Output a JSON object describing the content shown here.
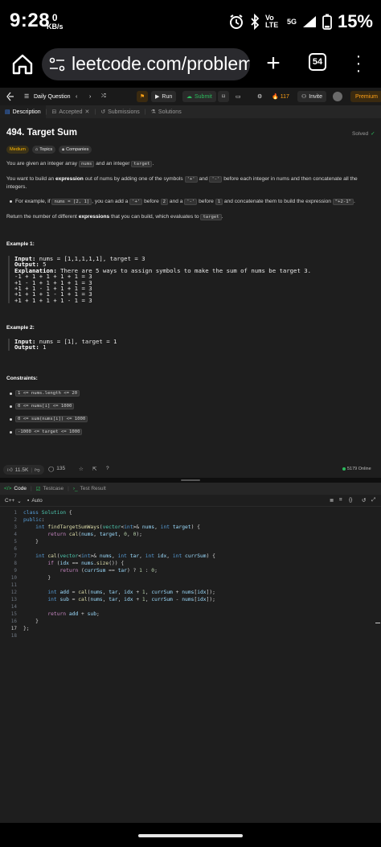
{
  "status_bar": {
    "time": "9:28",
    "net_speed_value": "0",
    "net_speed_unit": "KB/s",
    "network_label": "Vo LTE",
    "signal_label": "5G",
    "battery": "15%"
  },
  "browser": {
    "url": "leetcode.com/problem",
    "tab_count": "54"
  },
  "lc_toolbar": {
    "daily_question": "Daily Question",
    "run": "Run",
    "submit": "Submit",
    "streak": "117",
    "invite": "Invite",
    "premium": "Premium"
  },
  "desc_tabs": [
    {
      "label": "Description"
    },
    {
      "label": "Accepted"
    },
    {
      "label": "Submissions"
    },
    {
      "label": "Solutions"
    }
  ],
  "problem": {
    "title": "494. Target Sum",
    "solved": "Solved",
    "difficulty": "Medium",
    "topics": "Topics",
    "companies": "Companies",
    "p1": {
      "a": "You are given an integer array ",
      "b": "nums",
      "c": " and an integer ",
      "d": "target",
      "e": "."
    },
    "p2": {
      "a": "You want to build an ",
      "b": "expression",
      "c": " out of nums by adding one of the symbols ",
      "d": "'+'",
      "e": " and ",
      "f": "'-'",
      "g": " before each integer in nums and then concatenate all the",
      "h": "integers."
    },
    "p3": {
      "a": "For example, if ",
      "b": "nums = [2, 1]",
      "c": ", you can add a ",
      "d": "'+'",
      "e": " before ",
      "f": "2",
      "g": " and a ",
      "h": "'-'",
      "i": " before ",
      "j": "1",
      "k": " and concatenate them to build the expression ",
      "l": "\"+2-1\"",
      "m": "."
    },
    "p4": {
      "a": "Return the number of different ",
      "b": "expressions",
      "c": " that you can build, which evaluates to ",
      "d": "target",
      "e": "."
    },
    "example1": {
      "heading": "Example 1:",
      "input_label": "Input:",
      "input": " nums = [1,1,1,1,1], target = 3",
      "output_label": "Output:",
      "output": " 5",
      "explanation_label": "Explanation:",
      "explanation": " There are 5 ways to assign symbols to make the sum of nums be target 3.",
      "lines": [
        "-1 + 1 + 1 + 1 + 1 = 3",
        "+1 - 1 + 1 + 1 + 1 = 3",
        "+1 + 1 - 1 + 1 + 1 = 3",
        "+1 + 1 + 1 - 1 + 1 = 3",
        "+1 + 1 + 1 + 1 - 1 = 3"
      ]
    },
    "example2": {
      "heading": "Example 2:",
      "input_label": "Input:",
      "input": " nums = [1], target = 1",
      "output_label": "Output:",
      "output": " 1"
    },
    "constraints": {
      "heading": "Constraints:",
      "items": [
        "1 <= nums.length <= 20",
        "0 <= nums[i] <= 1000",
        "0 <= sum(nums[i]) <= 1000",
        "-1000 <= target <= 1000"
      ]
    },
    "likes": "11.5K",
    "comments": "135",
    "online": "5179 Online"
  },
  "code_panel": {
    "tabs": [
      {
        "label": "Code"
      },
      {
        "label": "Testcase"
      },
      {
        "label": "Test Result"
      }
    ],
    "language": "C++",
    "auto": "Auto",
    "line_numbers": [
      "1",
      "2",
      "3",
      "4",
      "5",
      "6",
      "7",
      "8",
      "9",
      "10",
      "11",
      "12",
      "13",
      "14",
      "15",
      "16",
      "17",
      "18"
    ]
  },
  "colors": {
    "accent_orange": "#ffa116",
    "success_green": "#2cbb5d",
    "difficulty_medium": "#ffb800",
    "background": "#1e1e1e"
  }
}
